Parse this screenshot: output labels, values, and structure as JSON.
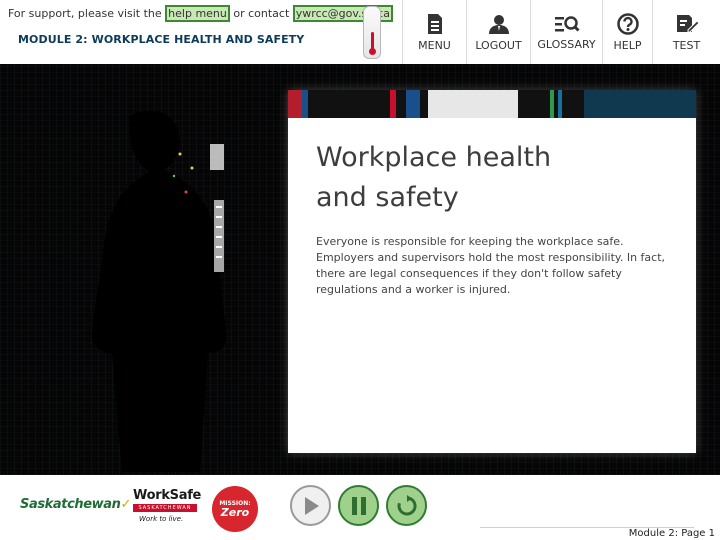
{
  "header": {
    "support_prefix": "For support, please visit the",
    "support_link": "help menu",
    "support_middle": "or contact",
    "support_email": "ywrcc@gov.sk.ca",
    "module_title": "MODULE 2: WORKPLACE HEALTH AND SAFETY"
  },
  "nav": [
    {
      "label": "MENU",
      "icon": "document-list-icon"
    },
    {
      "label": "LOGOUT",
      "icon": "user-icon"
    },
    {
      "label": "GLOSSARY",
      "icon": "search-list-icon"
    },
    {
      "label": "HELP",
      "icon": "question-icon"
    },
    {
      "label": "TEST",
      "icon": "edit-icon"
    }
  ],
  "card": {
    "title_line1": "Workplace health",
    "title_line2": "and safety",
    "body": "Everyone is responsible for keeping the workplace safe. Employers and supervisors hold the most responsibility. In fact, there are legal consequences if they don't follow safety regulations and a worker is injured."
  },
  "footer": {
    "sask_logo": "Saskatchewan",
    "worksafe_logo": "WorkSafe",
    "worksafe_sub": "SASKATCHEWAN",
    "worksafe_tagline": "Work to live.",
    "mission_zero_top": "MISSION:",
    "mission_zero_main": "Zero",
    "page_label": "Module 2: Page 1"
  },
  "controls": {
    "play": "play-icon",
    "pause": "pause-icon",
    "replay": "replay-icon"
  },
  "colors": {
    "accent_green": "#9fd08c",
    "accent_green_border": "#2f7d32",
    "module_title": "#0d3b5c",
    "brand_red": "#c8102e"
  }
}
